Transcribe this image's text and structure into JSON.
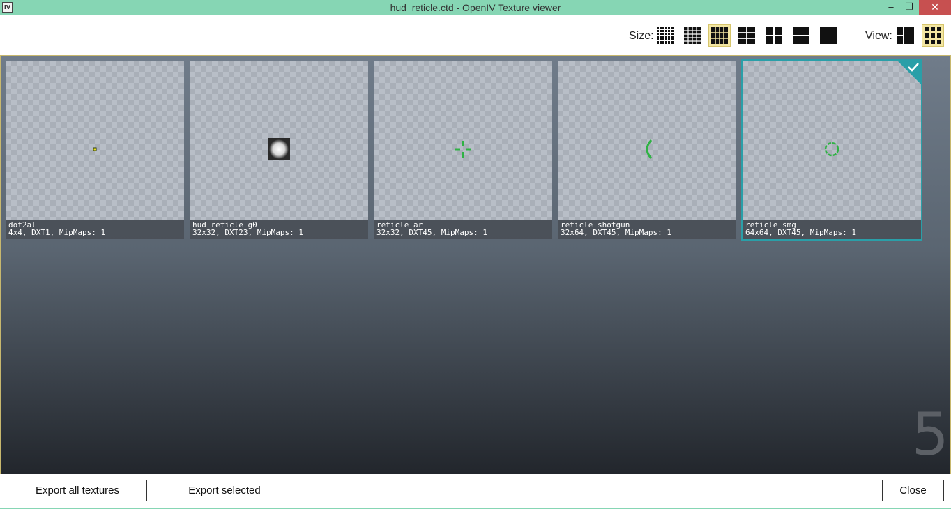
{
  "window": {
    "title": "hud_reticle.ctd - OpenIV Texture viewer",
    "app_icon": "IV",
    "minimize_glyph": "–",
    "restore_glyph": "❐",
    "close_glyph": "✕"
  },
  "toolbar": {
    "size_label": "Size:",
    "view_label": "View:",
    "size_options": [
      "grid-xxs-icon",
      "grid-xs-icon",
      "grid-s-icon",
      "grid-m-icon",
      "grid-l-icon",
      "grid-xl-icon",
      "grid-xxl-icon"
    ],
    "active_size": "grid-s-icon",
    "view_options": [
      "list-view-icon",
      "grid-view-icon"
    ],
    "active_view": "grid-view-icon"
  },
  "textures": [
    {
      "name": "dot2al",
      "info": "4x4, DXT1, MipMaps: 1",
      "preview": "dot"
    },
    {
      "name": "hud_reticle_g0",
      "info": "32x32, DXT23, MipMaps: 1",
      "preview": "glow-circle"
    },
    {
      "name": "reticle_ar",
      "info": "32x32, DXT45, MipMaps: 1",
      "preview": "crosshair"
    },
    {
      "name": "reticle_shotgun",
      "info": "32x64, DXT45, MipMaps: 1",
      "preview": "arc"
    },
    {
      "name": "reticle_smg",
      "info": "64x64, DXT45, MipMaps: 1",
      "preview": "dashed-circle",
      "selected": true
    }
  ],
  "texture_count": "5",
  "buttons": {
    "export_all": "Export all textures",
    "export_selected": "Export selected",
    "close": "Close"
  },
  "colors": {
    "titlebar": "#86d6b4",
    "accent_selected": "#2a9fa8",
    "reticle_green": "#2fb244",
    "active_toggle": "#f3e6a2"
  }
}
